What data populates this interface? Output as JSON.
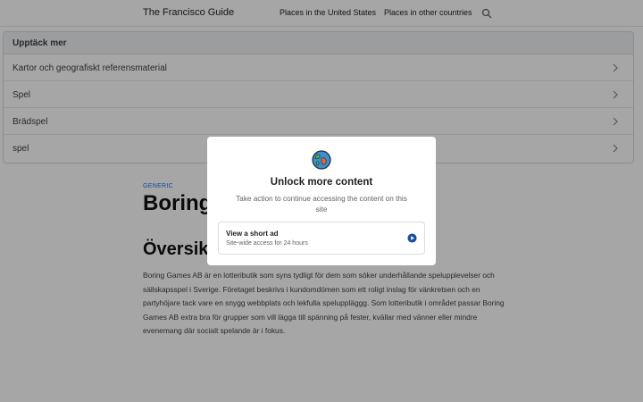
{
  "header": {
    "brand": "The Francisco Guide",
    "nav": [
      "Places in the United States",
      "Places in other countries"
    ],
    "search_icon": "search-icon"
  },
  "discover": {
    "heading": "Upptäck mer",
    "items": [
      {
        "label": "Kartor och geografiskt referensmaterial"
      },
      {
        "label": "Spel"
      },
      {
        "label": "Brädspel"
      },
      {
        "label": "spel"
      }
    ]
  },
  "article": {
    "kicker": "GENERIC",
    "title": "Boring G",
    "section_heading": "Översikt",
    "body": "Boring Games AB är en lotteributik som syns tydligt för dem som söker underhållande spelupplevelser och sällskapsspel i Sverige. Företaget beskrivs i kundomdömen som ett roligt inslag för vänkretsen och en partyhöjare tack vare en snygg webbplats och lekfulla speluppläggg. Som lotteributik i området passar Boring Games AB extra bra för grupper som vill lägga till spänning på fester, kvällar med vänner eller mindre evenemang där socialt spelande är i fokus."
  },
  "modal": {
    "icon": "globe-icon",
    "title": "Unlock more content",
    "description": "Take action to continue accessing the content on this site",
    "option": {
      "title": "View a short ad",
      "subtitle": "Site-wide access for 24 hours",
      "icon": "play-circle-icon"
    }
  },
  "colors": {
    "accent": "#1a73e8",
    "discover_header_bg": "#eef1f5"
  }
}
